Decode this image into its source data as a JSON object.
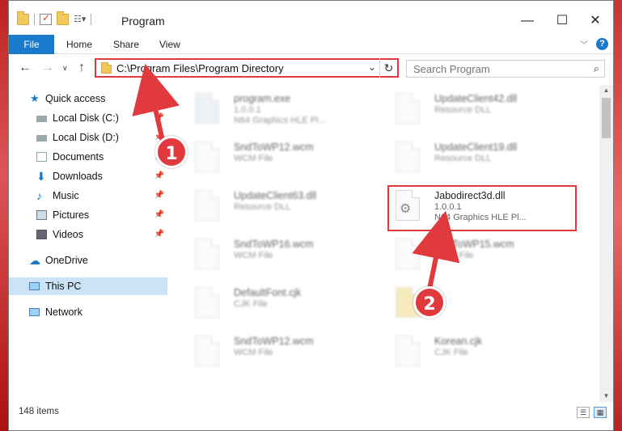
{
  "window": {
    "title": "Program"
  },
  "ribbon": {
    "tabs": [
      "File",
      "Home",
      "Share",
      "View"
    ]
  },
  "address": {
    "path": "C:\\Program Files\\Program Directory"
  },
  "search": {
    "placeholder": "Search Program"
  },
  "nav": {
    "items": [
      {
        "label": "Quick access",
        "icon": "star-icon"
      },
      {
        "label": "Local Disk (C:)",
        "icon": "drive-icon"
      },
      {
        "label": "Local Disk (D:)",
        "icon": "drive-icon"
      },
      {
        "label": "Documents",
        "icon": "documents-icon"
      },
      {
        "label": "Downloads",
        "icon": "downloads-icon"
      },
      {
        "label": "Music",
        "icon": "music-icon"
      },
      {
        "label": "Pictures",
        "icon": "pictures-icon"
      },
      {
        "label": "Videos",
        "icon": "videos-icon"
      },
      {
        "label": "OneDrive",
        "icon": "cloud-icon"
      },
      {
        "label": "This PC",
        "icon": "computer-icon",
        "selected": true
      },
      {
        "label": "Network",
        "icon": "network-icon"
      }
    ]
  },
  "files": [
    {
      "name": "program.exe",
      "line1": "1.0.0.1",
      "line2": "N64 Graphics HLE Pl..."
    },
    {
      "name": "UpdateClient42.dll",
      "line1": "Resource DLL",
      "line2": ""
    },
    {
      "name": "SndToWP12.wcm",
      "line1": "WCM File",
      "line2": ""
    },
    {
      "name": "UpdateClient19.dll",
      "line1": "Resource DLL",
      "line2": ""
    },
    {
      "name": "UpdateClient63.dll",
      "line1": "Resource DLL",
      "line2": ""
    },
    {
      "name": "Jabodirect3d.dll",
      "line1": "1.0.0.1",
      "line2": "N64 Graphics HLE Pl..."
    },
    {
      "name": "SndToWP16.wcm",
      "line1": "WCM File",
      "line2": ""
    },
    {
      "name": "SndToWP15.wcm",
      "line1": "WCM File",
      "line2": ""
    },
    {
      "name": "DefaultFont.cjk",
      "line1": "CJK File",
      "line2": ""
    },
    {
      "name": "",
      "line1": "",
      "line2": ""
    },
    {
      "name": "SndToWP12.wcm",
      "line1": "WCM File",
      "line2": ""
    },
    {
      "name": "Korean.cjk",
      "line1": "CJK File",
      "line2": ""
    }
  ],
  "status": {
    "count": "148 items"
  },
  "annotations": {
    "callout1": "1",
    "callout2": "2"
  },
  "colors": {
    "accent": "#1979ca",
    "highlight": "#e0393e"
  }
}
